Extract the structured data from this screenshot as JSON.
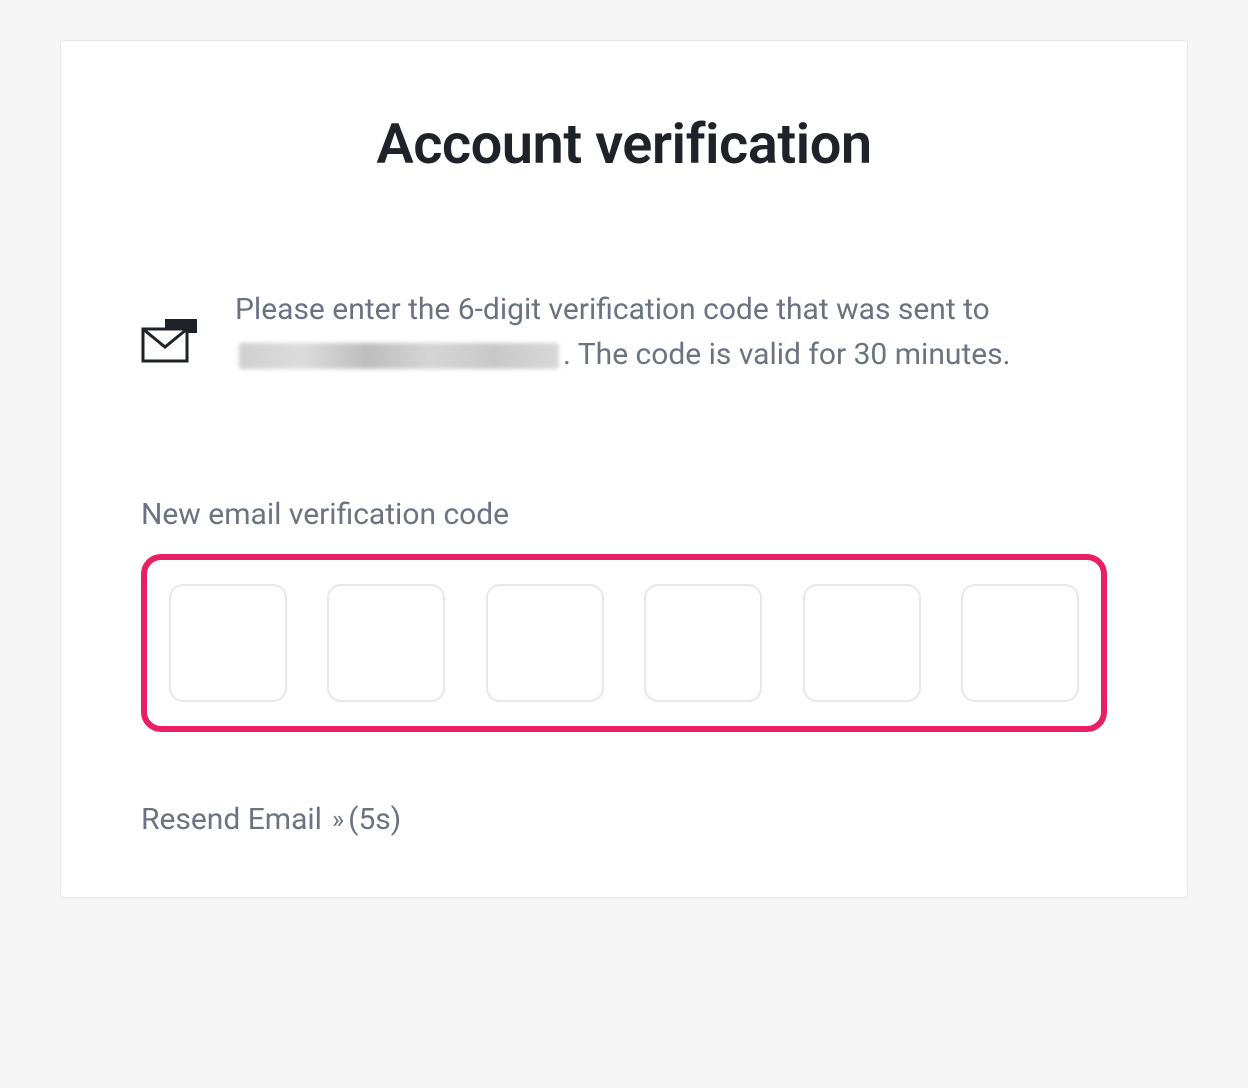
{
  "header": {
    "title": "Account verification"
  },
  "instruction": {
    "text_a": "Please enter the 6-digit verification code that was sent to",
    "text_b": ". The code is valid for 30 minutes."
  },
  "form": {
    "label": "New email verification code",
    "digits": [
      "",
      "",
      "",
      "",
      "",
      ""
    ]
  },
  "resend": {
    "label": "Resend Email",
    "cooldown": "(5s)"
  }
}
